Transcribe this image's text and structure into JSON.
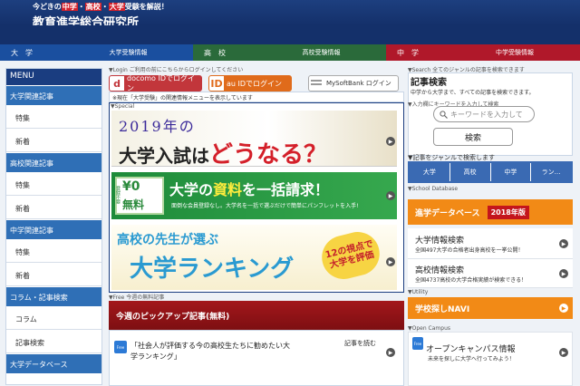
{
  "header": {
    "tagline_pre": "今どきの",
    "tagline_hl1": "中学",
    "tagline_sep1": "・",
    "tagline_hl2": "高校",
    "tagline_sep2": "・",
    "tagline_hl3": "大学",
    "tagline_post": "受験を解説！",
    "site_title": "教育進学総合研究所"
  },
  "nav": [
    {
      "label": "大　学",
      "sub": "大学受験情報",
      "color_head": "#1a4f9f",
      "color_sub": "#1a4f9f"
    },
    {
      "label": "高　校",
      "sub": "高校受験情報",
      "color_head": "#2a6a3a",
      "color_sub": "#2a6a3a"
    },
    {
      "label": "中　学",
      "sub": "中学受験情報",
      "color_head": "#b0182a",
      "color_sub": "#b0182a"
    }
  ],
  "menu": {
    "title": "MENU",
    "sections": [
      {
        "label": "大学関連記事",
        "items": [
          "特集",
          "新着"
        ]
      },
      {
        "label": "高校関連記事",
        "items": [
          "特集",
          "新着"
        ]
      },
      {
        "label": "中学関連記事",
        "items": [
          "特集",
          "新着"
        ]
      },
      {
        "label": "コラム・記事検索",
        "items": [
          "コラム",
          "記事検索"
        ]
      },
      {
        "label": "大学データベース",
        "items": []
      }
    ]
  },
  "login": {
    "label": "▼Login ご利用の前にこちらからログインしてください",
    "docomo_mark": "d",
    "docomo": "docomo IDでログイン",
    "au_mark": "ID",
    "au": "au IDでログイン",
    "sb": "MySoftBank ログイン"
  },
  "notice": "※現在「大学受験」の関連情報メニューを表示しています",
  "special_label": "▼Special",
  "banner1": {
    "year": "2019年の",
    "main_pre": "大学入試は",
    "main_em": "どうなる？"
  },
  "banner2": {
    "side": "登録不要",
    "free_num": "¥0",
    "free_txt": "無料",
    "title_pre": "大学の",
    "title_hl": "資料",
    "title_post": "を一括請求！",
    "sub": "面倒な会員登録なし。大学名を一括で選ぶだけで簡単にパンフレットを入手!"
  },
  "banner3": {
    "line1": "高校の先生が選ぶ",
    "line2": "大学ランキング",
    "stamp": "12の視点で 大学を評価"
  },
  "free_label": "▼Free 今週の無料記事",
  "pickup": {
    "head": "今週のピックアップ記事(無料)",
    "badge": "Free",
    "text": "「社会人が評価する今の高校生たちに勧めたい大学ランキング」",
    "more": "記事を読む"
  },
  "search": {
    "label": "▼Search 全てのジャンルの記事を検索できます",
    "title": "記事検索",
    "desc": "中学から大学まで、すべての記事を検索できます。",
    "hint": "▼入力欄にキーワードを入力して検索",
    "placeholder": "キーワードを入力して",
    "button": "検索",
    "genre_label": "▼記事をジャンルで検索します",
    "tabs": [
      "大学",
      "高校",
      "中学",
      "ラン…"
    ]
  },
  "schooldb": {
    "label": "▼School Database",
    "head": "進学データベース",
    "badge": "2018年版",
    "items": [
      {
        "title": "大学情報検索",
        "desc": "全国497大学の合格者出身高校を一挙公開！"
      },
      {
        "title": "高校情報検索",
        "desc": "全国4737高校の大学合格実績が検索できる！"
      }
    ]
  },
  "utility": {
    "label": "▼Utility",
    "navi": "学校探しNAVI"
  },
  "open": {
    "label": "▼Open Campus",
    "badge": "Free",
    "title": "オープンキャンパス情報",
    "desc": "未来を探しに大学へ行ってみよう！"
  }
}
